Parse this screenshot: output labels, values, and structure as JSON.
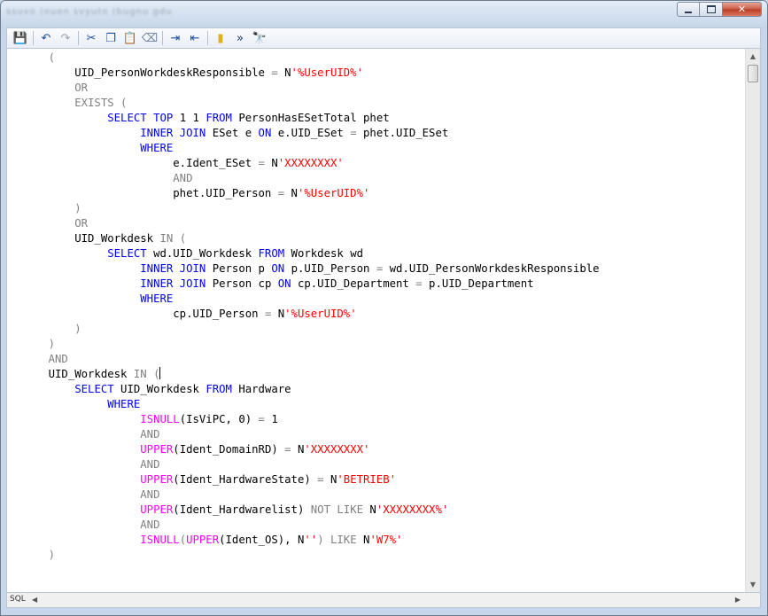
{
  "window": {
    "title_blurred": "ssuvo   (ouen   svyuto   (bugnu   gdu"
  },
  "toolbar": {
    "buttons": [
      {
        "name": "save-icon",
        "glyph": "💾",
        "color": "#1b4fa0"
      },
      {
        "name": "sep"
      },
      {
        "name": "undo-icon",
        "glyph": "↶",
        "color": "#1b4fa0"
      },
      {
        "name": "redo-icon",
        "glyph": "↷",
        "color": "#9aa4b2"
      },
      {
        "name": "sep"
      },
      {
        "name": "cut-icon",
        "glyph": "✂",
        "color": "#1b4fa0"
      },
      {
        "name": "copy-icon",
        "glyph": "❐",
        "color": "#1b4fa0"
      },
      {
        "name": "paste-icon",
        "glyph": "📋",
        "color": "#c79a2b"
      },
      {
        "name": "clear-icon",
        "glyph": "⌫",
        "color": "#6b7fa0"
      },
      {
        "name": "sep"
      },
      {
        "name": "indent-icon",
        "glyph": "⇥",
        "color": "#1b4fa0"
      },
      {
        "name": "outdent-icon",
        "glyph": "⇤",
        "color": "#1b4fa0"
      },
      {
        "name": "sep"
      },
      {
        "name": "ruler-icon",
        "glyph": "▮",
        "color": "#e0b020"
      },
      {
        "name": "goto-icon",
        "glyph": "»",
        "color": "#1b2f6a"
      },
      {
        "name": "find-icon",
        "glyph": "🔭",
        "color": "#333333"
      }
    ]
  },
  "code_lines": [
    [
      {
        "t": "    (",
        "c": "op"
      }
    ],
    [
      {
        "t": "        UID_PersonWorkdeskResponsible ",
        "c": ""
      },
      {
        "t": "=",
        "c": "op"
      },
      {
        "t": " N",
        "c": ""
      },
      {
        "t": "'%UserUID%'",
        "c": "str"
      }
    ],
    [
      {
        "t": "        OR",
        "c": "op"
      }
    ],
    [
      {
        "t": "        EXISTS (",
        "c": "op"
      }
    ],
    [
      {
        "t": "             ",
        "c": ""
      },
      {
        "t": "SELECT TOP",
        "c": "kw"
      },
      {
        "t": " 1 1 ",
        "c": "num"
      },
      {
        "t": "FROM",
        "c": "kw"
      },
      {
        "t": " PersonHasESetTotal phet",
        "c": ""
      }
    ],
    [
      {
        "t": "                  ",
        "c": ""
      },
      {
        "t": "INNER JOIN",
        "c": "kw"
      },
      {
        "t": " ESet e ",
        "c": ""
      },
      {
        "t": "ON",
        "c": "kw"
      },
      {
        "t": " e.UID_ESet ",
        "c": ""
      },
      {
        "t": "=",
        "c": "op"
      },
      {
        "t": " phet.UID_ESet",
        "c": ""
      }
    ],
    [
      {
        "t": "                  ",
        "c": ""
      },
      {
        "t": "WHERE",
        "c": "kw"
      }
    ],
    [
      {
        "t": "                       e.Ident_ESet ",
        "c": ""
      },
      {
        "t": "=",
        "c": "op"
      },
      {
        "t": " N",
        "c": ""
      },
      {
        "t": "'XXXXXXXX'",
        "c": "str"
      }
    ],
    [
      {
        "t": "                       AND",
        "c": "op"
      }
    ],
    [
      {
        "t": "                       phet.UID_Person ",
        "c": ""
      },
      {
        "t": "=",
        "c": "op"
      },
      {
        "t": " N",
        "c": ""
      },
      {
        "t": "'%UserUID%'",
        "c": "str"
      }
    ],
    [
      {
        "t": "        )",
        "c": "op"
      }
    ],
    [
      {
        "t": "        OR",
        "c": "op"
      }
    ],
    [
      {
        "t": "        UID_Workdesk ",
        "c": ""
      },
      {
        "t": "IN (",
        "c": "op"
      }
    ],
    [
      {
        "t": "             ",
        "c": ""
      },
      {
        "t": "SELECT",
        "c": "kw"
      },
      {
        "t": " wd.UID_Workdesk ",
        "c": ""
      },
      {
        "t": "FROM",
        "c": "kw"
      },
      {
        "t": " Workdesk wd",
        "c": ""
      }
    ],
    [
      {
        "t": "                  ",
        "c": ""
      },
      {
        "t": "INNER JOIN",
        "c": "kw"
      },
      {
        "t": " Person p ",
        "c": ""
      },
      {
        "t": "ON",
        "c": "kw"
      },
      {
        "t": " p.UID_Person ",
        "c": ""
      },
      {
        "t": "=",
        "c": "op"
      },
      {
        "t": " wd.UID_PersonWorkdeskResponsible",
        "c": ""
      }
    ],
    [
      {
        "t": "                  ",
        "c": ""
      },
      {
        "t": "INNER JOIN",
        "c": "kw"
      },
      {
        "t": " Person cp ",
        "c": ""
      },
      {
        "t": "ON",
        "c": "kw"
      },
      {
        "t": " cp.UID_Department ",
        "c": ""
      },
      {
        "t": "=",
        "c": "op"
      },
      {
        "t": " p.UID_Department",
        "c": ""
      }
    ],
    [
      {
        "t": "                  ",
        "c": ""
      },
      {
        "t": "WHERE",
        "c": "kw"
      }
    ],
    [
      {
        "t": "                       cp.UID_Person ",
        "c": ""
      },
      {
        "t": "=",
        "c": "op"
      },
      {
        "t": " N",
        "c": ""
      },
      {
        "t": "'%UserUID%'",
        "c": "str"
      }
    ],
    [
      {
        "t": "        )",
        "c": "op"
      }
    ],
    [
      {
        "t": "    )",
        "c": "op"
      }
    ],
    [
      {
        "t": "    AND",
        "c": "op"
      }
    ],
    [
      {
        "t": "    UID_Workdesk ",
        "c": ""
      },
      {
        "t": "IN (",
        "c": "op"
      },
      {
        "t": "",
        "c": "caret"
      }
    ],
    [
      {
        "t": "        ",
        "c": ""
      },
      {
        "t": "SELECT",
        "c": "kw"
      },
      {
        "t": " UID_Workdesk ",
        "c": ""
      },
      {
        "t": "FROM",
        "c": "kw"
      },
      {
        "t": " Hardware",
        "c": ""
      }
    ],
    [
      {
        "t": "             ",
        "c": ""
      },
      {
        "t": "WHERE",
        "c": "kw"
      }
    ],
    [
      {
        "t": "                  ",
        "c": ""
      },
      {
        "t": "ISNULL",
        "c": "fn"
      },
      {
        "t": "(IsViPC, ",
        "c": ""
      },
      {
        "t": "0",
        "c": "num"
      },
      {
        "t": ") ",
        "c": ""
      },
      {
        "t": "=",
        "c": "op"
      },
      {
        "t": " 1",
        "c": "num"
      }
    ],
    [
      {
        "t": "                  AND",
        "c": "op"
      }
    ],
    [
      {
        "t": "                  ",
        "c": ""
      },
      {
        "t": "UPPER",
        "c": "fn"
      },
      {
        "t": "(Ident_DomainRD) ",
        "c": ""
      },
      {
        "t": "=",
        "c": "op"
      },
      {
        "t": " N",
        "c": ""
      },
      {
        "t": "'XXXXXXXX'",
        "c": "str"
      }
    ],
    [
      {
        "t": "                  AND",
        "c": "op"
      }
    ],
    [
      {
        "t": "                  ",
        "c": ""
      },
      {
        "t": "UPPER",
        "c": "fn"
      },
      {
        "t": "(Ident_HardwareState) ",
        "c": ""
      },
      {
        "t": "=",
        "c": "op"
      },
      {
        "t": " N",
        "c": ""
      },
      {
        "t": "'BETRIEB'",
        "c": "str"
      }
    ],
    [
      {
        "t": "                  AND",
        "c": "op"
      }
    ],
    [
      {
        "t": "                  ",
        "c": ""
      },
      {
        "t": "UPPER",
        "c": "fn"
      },
      {
        "t": "(Ident_Hardwarelist) ",
        "c": ""
      },
      {
        "t": "NOT LIKE",
        "c": "op"
      },
      {
        "t": " N",
        "c": ""
      },
      {
        "t": "'XXXXXXXX%'",
        "c": "str"
      }
    ],
    [
      {
        "t": "                  AND",
        "c": "op"
      }
    ],
    [
      {
        "t": "                  ",
        "c": ""
      },
      {
        "t": "ISNULL",
        "c": "fn"
      },
      {
        "t": "(",
        "c": "op"
      },
      {
        "t": "UPPER",
        "c": "fn"
      },
      {
        "t": "(Ident_OS), N",
        "c": ""
      },
      {
        "t": "''",
        "c": "str"
      },
      {
        "t": ") ",
        "c": "op"
      },
      {
        "t": "LIKE",
        "c": "op"
      },
      {
        "t": " N",
        "c": ""
      },
      {
        "t": "'W7%'",
        "c": "str"
      }
    ],
    [
      {
        "t": "    )",
        "c": "op"
      }
    ]
  ],
  "statusbar": {
    "mode": "SQL",
    "scroll_left": "◀",
    "scroll_right": "▶"
  },
  "scrollbar": {
    "up": "▲",
    "down": "▼"
  },
  "window_buttons": {
    "minimize": "",
    "maximize": "",
    "close": "✕"
  }
}
